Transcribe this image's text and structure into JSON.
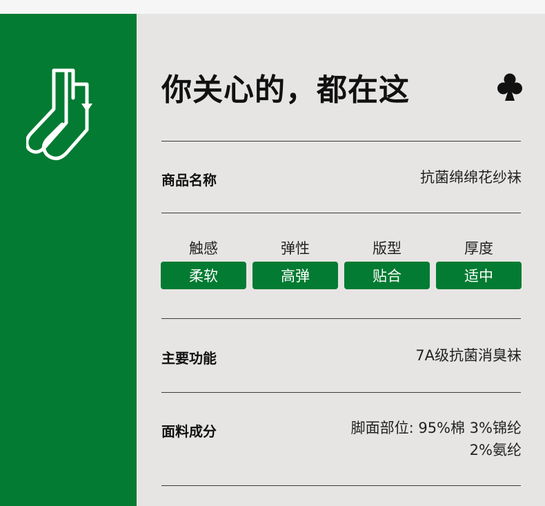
{
  "title": "你关心的，都在这",
  "rows": {
    "product_name": {
      "label": "商品名称",
      "value": "抗菌绵绵花纱袜"
    },
    "function": {
      "label": "主要功能",
      "value": "7A级抗菌消臭袜"
    },
    "material": {
      "label": "面料成分",
      "value_line1": "脚面部位: 95%棉 3%锦纶",
      "value_line2": "2%氨纶"
    }
  },
  "attributes": [
    {
      "name": "触感",
      "value": "柔软"
    },
    {
      "name": "弹性",
      "value": "高弹"
    },
    {
      "name": "版型",
      "value": "贴合"
    },
    {
      "name": "厚度",
      "value": "适中"
    }
  ],
  "colors": {
    "brand_green": "#037b32",
    "panel_bg": "#e6e5e4"
  },
  "icons": {
    "sidebar": "sock-icon",
    "title": "club-icon"
  }
}
